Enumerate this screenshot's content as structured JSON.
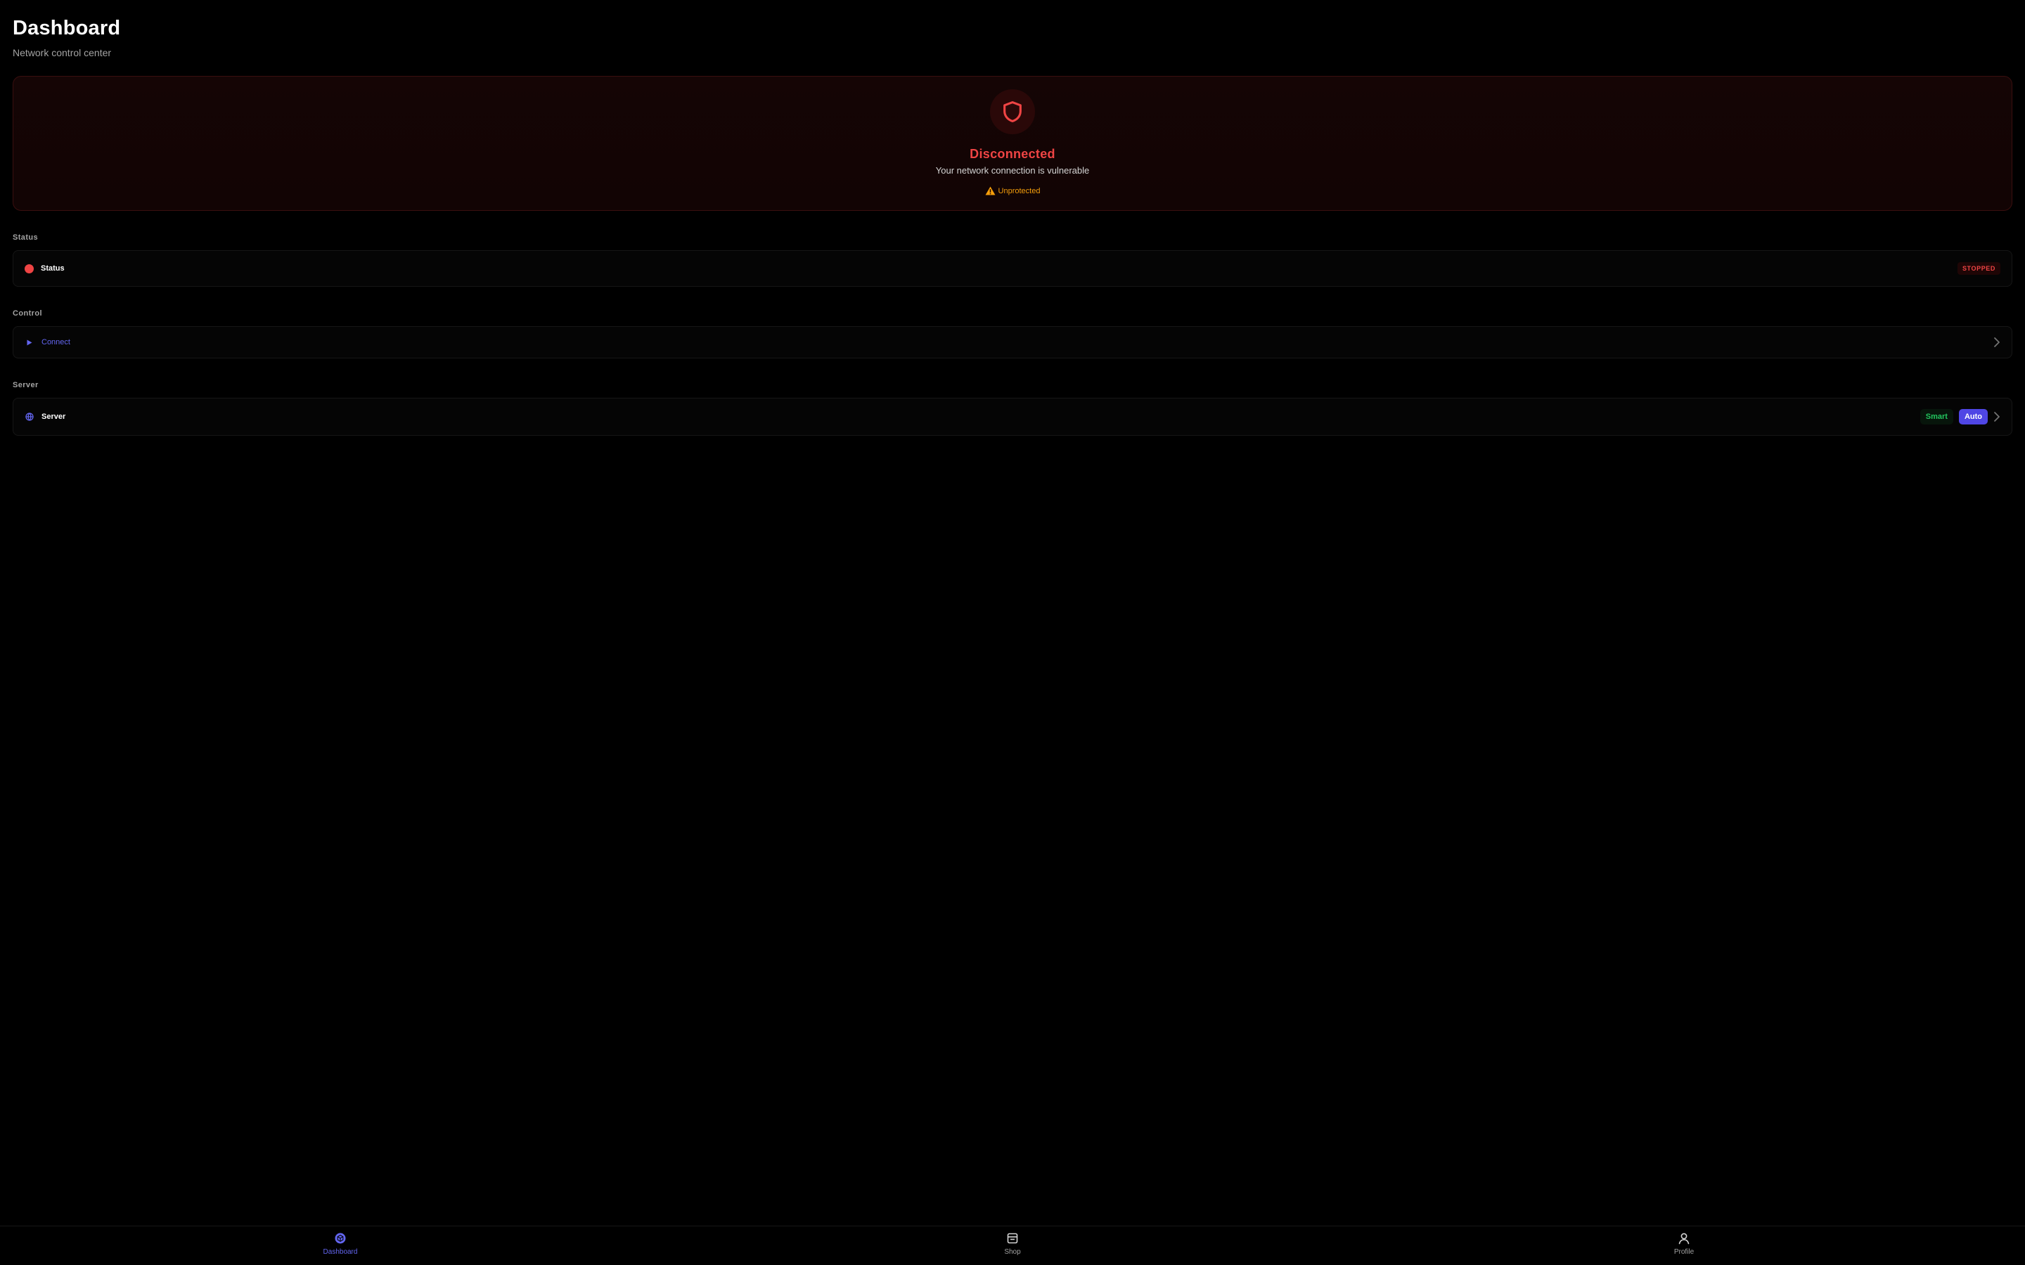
{
  "header": {
    "title": "Dashboard",
    "subtitle": "Network control center"
  },
  "hero": {
    "icon": "shield-icon",
    "status": "Disconnected",
    "description": "Your network connection is vulnerable",
    "warning_icon": "warning-triangle-icon",
    "warning": "Unprotected",
    "colors": {
      "status": "#ef4444",
      "warning": "#f59e0b"
    }
  },
  "sections": {
    "status": {
      "heading": "Status",
      "label": "Status",
      "badge": "STOPPED",
      "indicator_color": "#ef4444"
    },
    "control": {
      "heading": "Control",
      "label": "Connect",
      "icon": "play-icon"
    },
    "server": {
      "heading": "Server",
      "label": "Server",
      "icon": "globe-icon",
      "mode_smart": "Smart",
      "mode_auto": "Auto",
      "selected_mode": "Auto"
    }
  },
  "nav": {
    "items": [
      {
        "label": "Dashboard",
        "icon": "dashboard-icon",
        "active": true
      },
      {
        "label": "Shop",
        "icon": "shop-icon",
        "active": false
      },
      {
        "label": "Profile",
        "icon": "profile-icon",
        "active": false
      }
    ]
  },
  "colors": {
    "accent": "#6366f1",
    "background": "#000000",
    "success": "#22c55e"
  }
}
